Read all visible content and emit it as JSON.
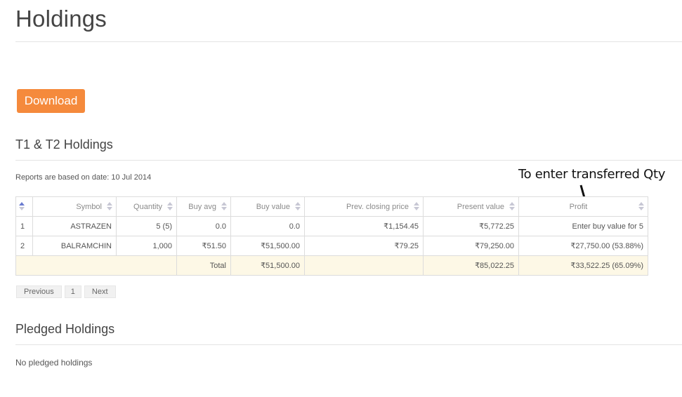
{
  "page": {
    "title": "Holdings"
  },
  "download": {
    "label": "Download"
  },
  "t1t2": {
    "title": "T1 & T2 Holdings",
    "report_date": "Reports are based on date: 10 Jul 2014",
    "columns": [
      "Symbol",
      "Quantity",
      "Buy avg",
      "Buy value",
      "Prev. closing price",
      "Present value",
      "Profit"
    ],
    "rows": [
      {
        "idx": "1",
        "symbol": "ASTRAZEN",
        "quantity": "5 (5)",
        "buy_avg": "0.0",
        "buy_value": "0.0",
        "prev_close": "₹1,154.45",
        "present_value": "₹5,772.25",
        "profit": "Enter buy value for 5"
      },
      {
        "idx": "2",
        "symbol": "BALRAMCHIN",
        "quantity": "1,000",
        "buy_avg": "₹51.50",
        "buy_value": "₹51,500.00",
        "prev_close": "₹79.25",
        "present_value": "₹79,250.00",
        "profit": "₹27,750.00 (53.88%)"
      }
    ],
    "total": {
      "label": "Total",
      "buy_value": "₹51,500.00",
      "present_value": "₹85,022.25",
      "profit": "₹33,522.25 (65.09%)"
    }
  },
  "pagination": {
    "previous": "Previous",
    "page": "1",
    "next": "Next"
  },
  "annotation": {
    "text": "To enter transferred Qty"
  },
  "pledged": {
    "title": "Pledged Holdings",
    "empty": "No pledged holdings"
  },
  "colors": {
    "accent": "#f58a3c",
    "total_row": "#fdf8e6",
    "sort_active": "#6a7bd0"
  }
}
